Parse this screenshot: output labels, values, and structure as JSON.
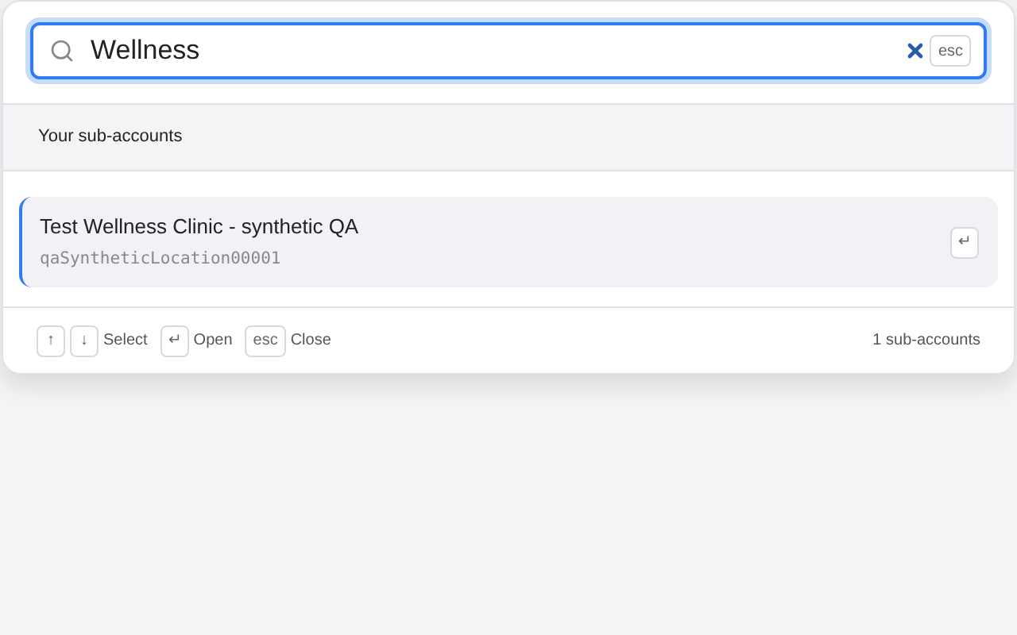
{
  "search": {
    "value": "Wellness",
    "esc_key": "esc"
  },
  "section_title": "Your sub-accounts",
  "results": [
    {
      "name": "Test Wellness Clinic - synthetic QA",
      "id": "qaSyntheticLocation00001",
      "key": "↵",
      "selected": true
    }
  ],
  "footer": {
    "hints": [
      {
        "keys": [
          "↑",
          "↓"
        ],
        "label": "Select"
      },
      {
        "keys": [
          "↵"
        ],
        "label": "Open"
      },
      {
        "keys": [
          "esc"
        ],
        "label": "Close"
      }
    ],
    "count": "1 sub-accounts"
  }
}
